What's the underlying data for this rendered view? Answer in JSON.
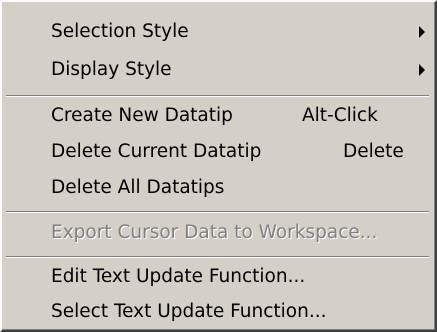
{
  "menu": {
    "selection_style": {
      "label": "Selection Style",
      "submenu_icon": "submenu-arrow-icon"
    },
    "display_style": {
      "label": "Display Style",
      "submenu_icon": "submenu-arrow-icon"
    },
    "create_new_datatip": {
      "label": "Create New Datatip",
      "shortcut": "Alt-Click"
    },
    "delete_current_datatip": {
      "label": "Delete Current Datatip",
      "shortcut": "Delete"
    },
    "delete_all_datatips": {
      "label": "Delete All Datatips"
    },
    "export_cursor_data": {
      "label": "Export Cursor Data to Workspace...",
      "enabled": false
    },
    "edit_text_update_function": {
      "label": "Edit Text Update Function..."
    },
    "select_text_update_function": {
      "label": "Select Text Update Function..."
    }
  },
  "colors": {
    "menu_background": "#d4d0c8",
    "text": "#000000",
    "disabled_text": "#808080"
  }
}
